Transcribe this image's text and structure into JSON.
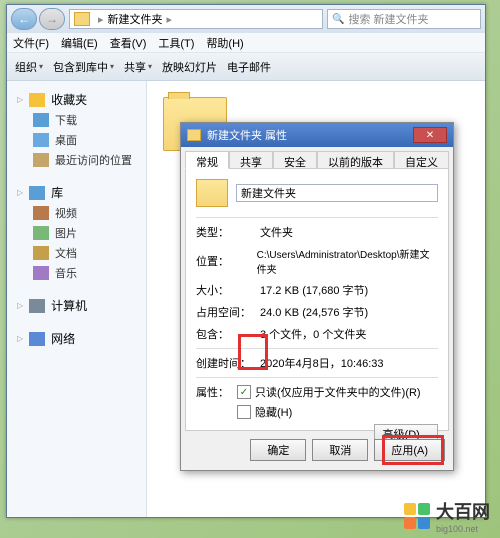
{
  "explorer": {
    "breadcrumb_root": "",
    "breadcrumb_folder": "新建文件夹",
    "search_placeholder": "搜索 新建文件夹",
    "menu": {
      "file": "文件(F)",
      "edit": "编辑(E)",
      "view": "查看(V)",
      "tools": "工具(T)",
      "help": "帮助(H)"
    },
    "toolbar": {
      "organize": "组织",
      "include": "包含到库中",
      "share": "共享",
      "slideshow": "放映幻灯片",
      "email": "电子邮件"
    }
  },
  "sidebar": {
    "favorites": "收藏夹",
    "downloads": "下载",
    "desktop": "桌面",
    "recent": "最近访问的位置",
    "libraries": "库",
    "videos": "视频",
    "pictures": "图片",
    "documents": "文档",
    "music": "音乐",
    "computer": "计算机",
    "network": "网络"
  },
  "dialog": {
    "title": "新建文件夹 属性",
    "tabs": {
      "general": "常规",
      "sharing": "共享",
      "security": "安全",
      "previous": "以前的版本",
      "customize": "自定义"
    },
    "name_value": "新建文件夹",
    "rows": {
      "type_lbl": "类型：",
      "type_val": "文件夹",
      "location_lbl": "位置：",
      "location_val": "C:\\Users\\Administrator\\Desktop\\新建文件夹",
      "size_lbl": "大小：",
      "size_val": "17.2 KB (17,680 字节)",
      "sizeondisk_lbl": "占用空间：",
      "sizeondisk_val": "24.0 KB (24,576 字节)",
      "contains_lbl": "包含：",
      "contains_val": "3 个文件，0 个文件夹",
      "created_lbl": "创建时间：",
      "created_val": "2020年4月8日，10:46:33",
      "attr_lbl": "属性："
    },
    "readonly": "只读(仅应用于文件夹中的文件)(R)",
    "hidden": "隐藏(H)",
    "advanced": "高级(D)...",
    "buttons": {
      "ok": "确定",
      "cancel": "取消",
      "apply": "应用(A)"
    }
  },
  "watermark": {
    "name": "大百网",
    "sub": "big100.net"
  }
}
